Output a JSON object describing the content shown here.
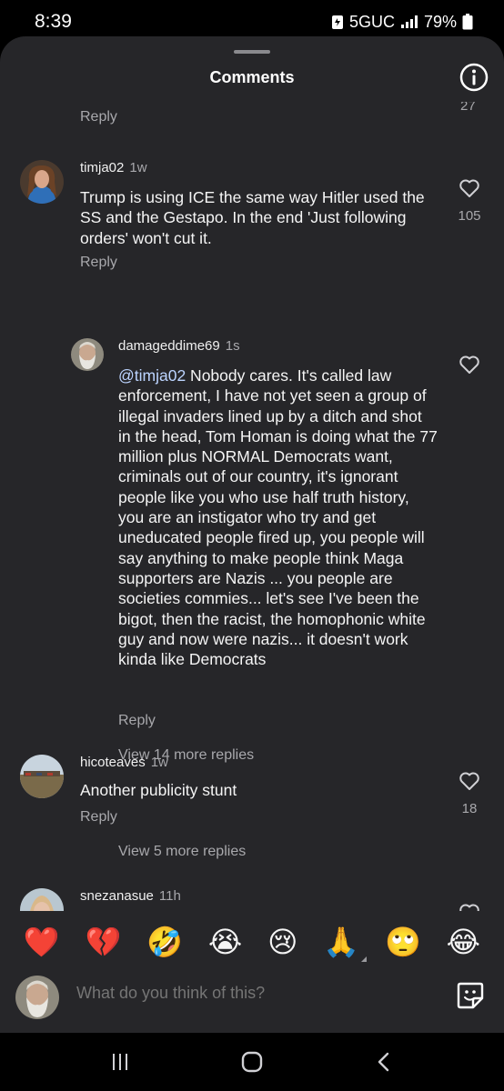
{
  "status": {
    "time": "8:39",
    "network": "5GUC",
    "battery": "79%"
  },
  "sheet": {
    "title": "Comments"
  },
  "prev_comment": {
    "reply_label": "Reply",
    "like_count": "27"
  },
  "comments": [
    {
      "username": "timja02",
      "time": "1w",
      "text": "Trump is using ICE the same way Hitler used the SS and the Gestapo.  In the end 'Just following orders' won't cut it.",
      "reply_label": "Reply",
      "like_count": "105"
    },
    {
      "username": "damageddime69",
      "time": "1s",
      "mention": "@timja02",
      "text": " Nobody cares. It's called law enforcement,  I have not yet seen a group of illegal invaders lined up by a ditch and shot in the head, Tom Homan is doing what the 77 million plus NORMAL Democrats want, criminals out of our country, it's ignorant people like you who use half truth history, you are an instigator who try and get uneducated people fired up, you people will say anything to make people think Maga supporters are Nazis ... you people are societies commies... let's see I've been the bigot,  then the racist, the homophonic white guy and now were nazis... it doesn't work kinda like Democrats",
      "reply_label": "Reply",
      "view_more": "View 14 more replies"
    },
    {
      "username": "hicoteaves",
      "time": "1w",
      "text": "Another publicity stunt",
      "reply_label": "Reply",
      "like_count": "18",
      "view_more": "View 5 more replies"
    },
    {
      "username": "snezanasue",
      "time": "11h"
    }
  ],
  "reactions": [
    "❤️",
    "💔",
    "🤣",
    "😭",
    "😢",
    "🙏",
    "🙄",
    "😂"
  ],
  "input": {
    "placeholder": "What do you think of this?"
  }
}
